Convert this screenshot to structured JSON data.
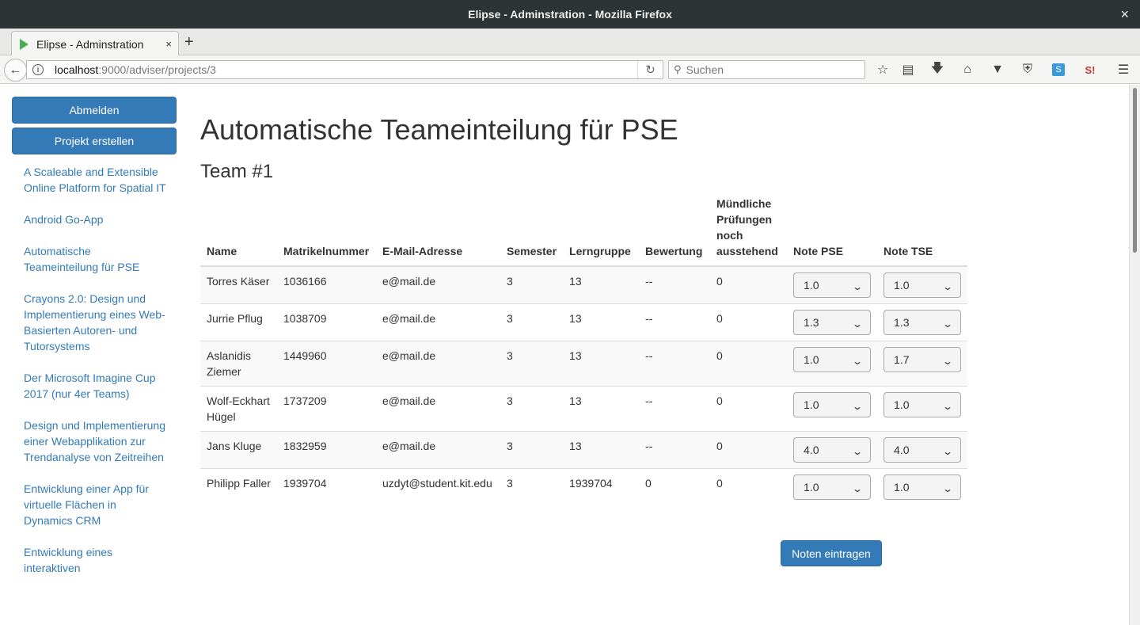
{
  "window": {
    "title": "Elipse - Adminstration - Mozilla Firefox",
    "close_glyph": "×"
  },
  "tabs": [
    {
      "label": "Elipse - Adminstration",
      "close_glyph": "×"
    }
  ],
  "new_tab_glyph": "+",
  "nav": {
    "url_host": "localhost",
    "url_rest": ":9000/adviser/projects/3",
    "search_placeholder": "Suchen"
  },
  "sidebar": {
    "logout_label": "Abmelden",
    "create_project_label": "Projekt erstellen",
    "projects": [
      "A Scaleable and Extensible Online Platform for Spatial IT",
      "Android Go-App",
      "Automatische Teameinteilung für PSE",
      "Crayons 2.0: Design und Implementierung eines Web-Basierten Autoren- und Tutorsystems",
      "Der Microsoft Imagine Cup 2017 (nur 4er Teams)",
      "Design und Implementierung einer Webapplikation zur Trendanalyse von Zeitreihen",
      "Entwicklung einer App für virtuelle Flächen in Dynamics CRM",
      "Entwicklung eines interaktiven"
    ]
  },
  "main": {
    "title": "Automatische Teameinteilung für PSE",
    "team_title": "Team #1",
    "columns": [
      "Name",
      "Matrikelnummer",
      "E-Mail-Adresse",
      "Semester",
      "Lerngruppe",
      "Bewertung",
      "Mündliche Prüfungen noch ausstehend",
      "Note PSE",
      "Note TSE"
    ],
    "rows": [
      {
        "name": "Torres Käser",
        "matrikel": "1036166",
        "email": "e@mail.de",
        "semester": "3",
        "group": "13",
        "rating": "--",
        "oral": "0",
        "pse": "1.0",
        "tse": "1.0"
      },
      {
        "name": "Jurrie Pflug",
        "matrikel": "1038709",
        "email": "e@mail.de",
        "semester": "3",
        "group": "13",
        "rating": "--",
        "oral": "0",
        "pse": "1.3",
        "tse": "1.3"
      },
      {
        "name": "Aslanidis Ziemer",
        "matrikel": "1449960",
        "email": "e@mail.de",
        "semester": "3",
        "group": "13",
        "rating": "--",
        "oral": "0",
        "pse": "1.0",
        "tse": "1.7"
      },
      {
        "name": "Wolf-Eckhart Hügel",
        "matrikel": "1737209",
        "email": "e@mail.de",
        "semester": "3",
        "group": "13",
        "rating": "--",
        "oral": "0",
        "pse": "1.0",
        "tse": "1.0"
      },
      {
        "name": "Jans Kluge",
        "matrikel": "1832959",
        "email": "e@mail.de",
        "semester": "3",
        "group": "13",
        "rating": "--",
        "oral": "0",
        "pse": "4.0",
        "tse": "4.0"
      },
      {
        "name": "Philipp Faller",
        "matrikel": "1939704",
        "email": "uzdyt@student.kit.edu",
        "semester": "3",
        "group": "1939704",
        "rating": "0",
        "oral": "0",
        "pse": "1.0",
        "tse": "1.0"
      }
    ],
    "submit_label": "Noten eintragen"
  }
}
